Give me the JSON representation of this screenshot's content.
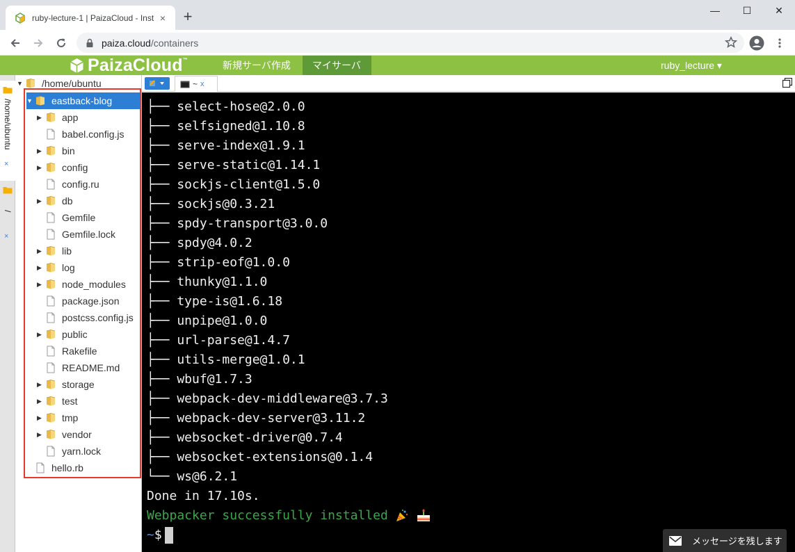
{
  "browser": {
    "tab_title": "ruby-lecture-1 | PaizaCloud - Inst",
    "tab_close": "×",
    "new_tab": "+",
    "url_host": "paiza.cloud",
    "url_path": "/containers",
    "window_controls": {
      "minimize": "—",
      "maximize": "☐",
      "close": "✕"
    }
  },
  "header": {
    "logo_text": "PaizaCloud",
    "logo_tm": "™",
    "nav": [
      {
        "label": "新規サーバ作成"
      },
      {
        "label": "マイサーバ"
      }
    ],
    "user": "ruby_lecture ▾"
  },
  "vtabs": {
    "tab1_label": "/home/ubuntu",
    "tab1_close": "×",
    "tab2_label": "/",
    "tab2_close": "×"
  },
  "filetree": {
    "root": "/home/ubuntu",
    "project": "eastback-blog",
    "items": [
      {
        "name": "app",
        "type": "folder"
      },
      {
        "name": "babel.config.js",
        "type": "file"
      },
      {
        "name": "bin",
        "type": "folder"
      },
      {
        "name": "config",
        "type": "folder"
      },
      {
        "name": "config.ru",
        "type": "file"
      },
      {
        "name": "db",
        "type": "folder"
      },
      {
        "name": "Gemfile",
        "type": "file"
      },
      {
        "name": "Gemfile.lock",
        "type": "file"
      },
      {
        "name": "lib",
        "type": "folder"
      },
      {
        "name": "log",
        "type": "folder"
      },
      {
        "name": "node_modules",
        "type": "folder"
      },
      {
        "name": "package.json",
        "type": "file"
      },
      {
        "name": "postcss.config.js",
        "type": "file"
      },
      {
        "name": "public",
        "type": "folder"
      },
      {
        "name": "Rakefile",
        "type": "file"
      },
      {
        "name": "README.md",
        "type": "file"
      },
      {
        "name": "storage",
        "type": "folder"
      },
      {
        "name": "test",
        "type": "folder"
      },
      {
        "name": "tmp",
        "type": "folder"
      },
      {
        "name": "vendor",
        "type": "folder"
      },
      {
        "name": "yarn.lock",
        "type": "file"
      }
    ],
    "root_file": "hello.rb"
  },
  "terminal_tabs": {
    "tab_label": "~",
    "tab_close": "x"
  },
  "terminal": {
    "lines": [
      "├── select-hose@2.0.0",
      "├── selfsigned@1.10.8",
      "├── serve-index@1.9.1",
      "├── serve-static@1.14.1",
      "├── sockjs-client@1.5.0",
      "├── sockjs@0.3.21",
      "├── spdy-transport@3.0.0",
      "├── spdy@4.0.2",
      "├── strip-eof@1.0.0",
      "├── thunky@1.1.0",
      "├── type-is@1.6.18",
      "├── unpipe@1.0.0",
      "├── url-parse@1.4.7",
      "├── utils-merge@1.0.1",
      "├── wbuf@1.7.3",
      "├── webpack-dev-middleware@3.7.3",
      "├── webpack-dev-server@3.11.2",
      "├── websocket-driver@0.7.4",
      "├── websocket-extensions@0.1.4",
      "└── ws@6.2.1"
    ],
    "done_line": "Done in 17.10s.",
    "success_line": "Webpacker successfully installed",
    "prompt_tilde": "~",
    "prompt_symbol": "$"
  },
  "message_button": "メッセージを残します",
  "colors": {
    "header_green": "#8dc144",
    "active_nav": "#5e9a38",
    "selected_blue": "#2d7fd6",
    "highlight_red": "#e8392a",
    "terminal_green": "#3aa64a"
  }
}
